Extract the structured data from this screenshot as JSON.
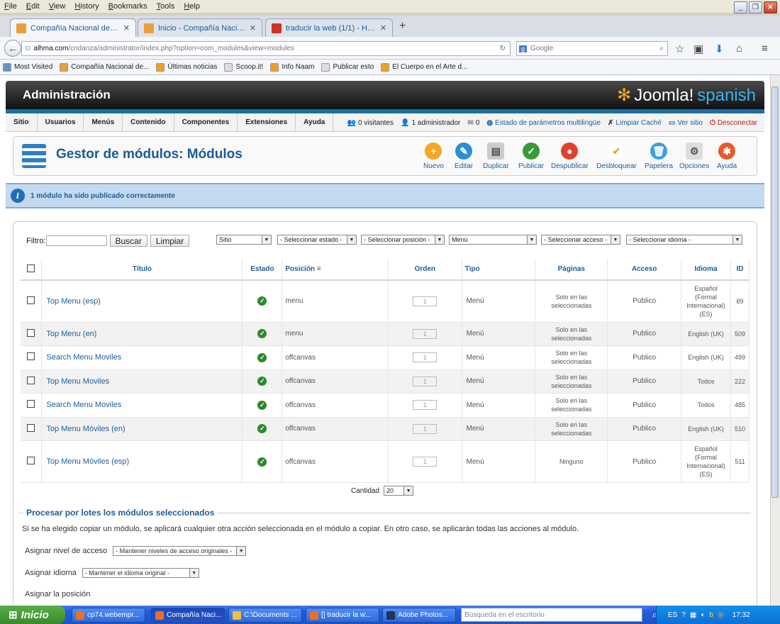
{
  "menubar": [
    "File",
    "Edit",
    "View",
    "History",
    "Bookmarks",
    "Tools",
    "Help"
  ],
  "tabs": [
    {
      "label": "Compañía Nacional de Danza....",
      "color": "#e8a03a"
    },
    {
      "label": "Inicio - Compañía Nacional de ...",
      "color": "#e8a03a"
    },
    {
      "label": "traducir la web (1/1) - Hostin...",
      "color": "#cc3322"
    }
  ],
  "url": {
    "host": "alhma.com",
    "path": "/cndanza/administrator/index.php?option=com_modules&view=modules"
  },
  "search_placeholder": "Google",
  "bookmarks": [
    {
      "label": "Most Visited",
      "color": "#6b8fc9"
    },
    {
      "label": "Compañía Nacional de...",
      "color": "#e8a03a"
    },
    {
      "label": "Últimas noticias",
      "color": "#f0a020"
    },
    {
      "label": "Scoop.it!",
      "color": "#dddddd"
    },
    {
      "label": "Info Naam",
      "color": "#f0a020"
    },
    {
      "label": "Publicar esto",
      "color": "#dddddd"
    },
    {
      "label": "El Cuerpo en el Arte d...",
      "color": "#f0a020"
    }
  ],
  "admin": {
    "title": "Administración",
    "brand": "Joomla!",
    "brand_suffix": "spanish"
  },
  "mainmenu": [
    "Sitio",
    "Usuarios",
    "Menús",
    "Contenido",
    "Componentes",
    "Extensiones",
    "Ayuda"
  ],
  "status": {
    "visitors": "0 visitantes",
    "admins": "1 administrador",
    "messages": "0",
    "multilang": "Estado de parámetros multilingüe",
    "cache": "Limpiar Caché",
    "site": "Ver sitio",
    "logout": "Desconectar"
  },
  "page_title": "Gestor de módulos: Módulos",
  "toolbar": [
    {
      "label": "Nuevo",
      "color": "#f5a623",
      "glyph": "+"
    },
    {
      "label": "Editar",
      "color": "#2a8fd6",
      "glyph": "✎"
    },
    {
      "label": "Duplicar",
      "color": "#cccccc",
      "glyph": "▤"
    },
    {
      "label": "Publicar",
      "color": "#3a9a36",
      "glyph": "✓"
    },
    {
      "label": "Despublicar",
      "color": "#e0412a",
      "glyph": "●"
    },
    {
      "label": "Desbloquear",
      "color": "#ffffff",
      "glyph": "✔"
    },
    {
      "label": "Papelera",
      "color": "#3aa0e0",
      "glyph": "🗑"
    },
    {
      "label": "Opciones",
      "color": "#dddddd",
      "glyph": "⚙"
    },
    {
      "label": "Ayuda",
      "color": "#e85a2a",
      "glyph": "✱"
    }
  ],
  "message": "1 módulo ha sido publicado correctamente",
  "filter": {
    "label": "Filtro:",
    "search": "Buscar",
    "clear": "Limpiar",
    "selects": [
      "Sitio",
      "- Seleccionar estado -",
      "- Seleccionar posición -",
      "Menú",
      "- Seleccionar acceso -",
      "- Seleccionar idioma -"
    ]
  },
  "columns": [
    "Título",
    "Estado",
    "Posición",
    "Orden",
    "Tipo",
    "Páginas",
    "Acceso",
    "Idioma",
    "ID"
  ],
  "rows": [
    {
      "title": "Top Menu (esp)",
      "position": "menu",
      "order": "1",
      "type": "Menú",
      "pages": "Solo en las seleccionadas",
      "access": "Publico",
      "language": "Español (Formal Internacional) (ES)",
      "id": "89"
    },
    {
      "title": "Top Menu (en)",
      "position": "menu",
      "order": "1",
      "type": "Menú",
      "pages": "Solo en las seleccionadas",
      "access": "Publico",
      "language": "English (UK)",
      "id": "509"
    },
    {
      "title": "Search Menu Moviles",
      "position": "offcanvas",
      "order": "1",
      "type": "Menú",
      "pages": "Solo en las seleccionadas",
      "access": "Publico",
      "language": "English (UK)",
      "id": "499"
    },
    {
      "title": "Top Menu Moviles",
      "position": "offcanvas",
      "order": "1",
      "type": "Menú",
      "pages": "Solo en las seleccionadas",
      "access": "Publico",
      "language": "Todos",
      "id": "222"
    },
    {
      "title": "Search Menu Moviles",
      "position": "offcanvas",
      "order": "1",
      "type": "Menú",
      "pages": "Solo en las seleccionadas",
      "access": "Publico",
      "language": "Todos",
      "id": "485"
    },
    {
      "title": "Top Menu Móviles (en)",
      "position": "offcanvas",
      "order": "1",
      "type": "Menú",
      "pages": "Solo en las seleccionadas",
      "access": "Publico",
      "language": "English (UK)",
      "id": "510"
    },
    {
      "title": "Top Menu Móviles (esp)",
      "position": "offcanvas",
      "order": "1",
      "type": "Menú",
      "pages": "Ninguno",
      "access": "Publico",
      "language": "Español (Formal Internacional) (ES)",
      "id": "511"
    }
  ],
  "pagination": {
    "label": "Cantidad",
    "value": "20"
  },
  "batch": {
    "legend": "Procesar por lotes los módulos seleccionados",
    "description": "Si se ha elegido copiar un módulo, se aplicará cualquier otra acción seleccionada en el módulo a copiar. En otro caso, se aplicarán todas las acciones al módulo.",
    "access_label": "Asignar nivel de acceso",
    "access_value": "- Mantener niveles de acceso originales -",
    "lang_label": "Asignar idioma",
    "lang_value": "- Mantener el idioma original -",
    "pos_label": "Asignar la posición"
  },
  "taskbar": {
    "start": "Inicio",
    "items": [
      {
        "label": "cp74.webempr...",
        "color": "#e8702a"
      },
      {
        "label": "Compañía Naci...",
        "color": "#e8702a"
      },
      {
        "label": "C:\\Documents ...",
        "color": "#f0c040"
      },
      {
        "label": "[] traducir la w...",
        "color": "#e8702a"
      },
      {
        "label": "Adobe Photos...",
        "color": "#223355"
      }
    ],
    "search_placeholder": "Búsqueda en el escritorio",
    "lang": "ES",
    "clock": "17:32"
  }
}
